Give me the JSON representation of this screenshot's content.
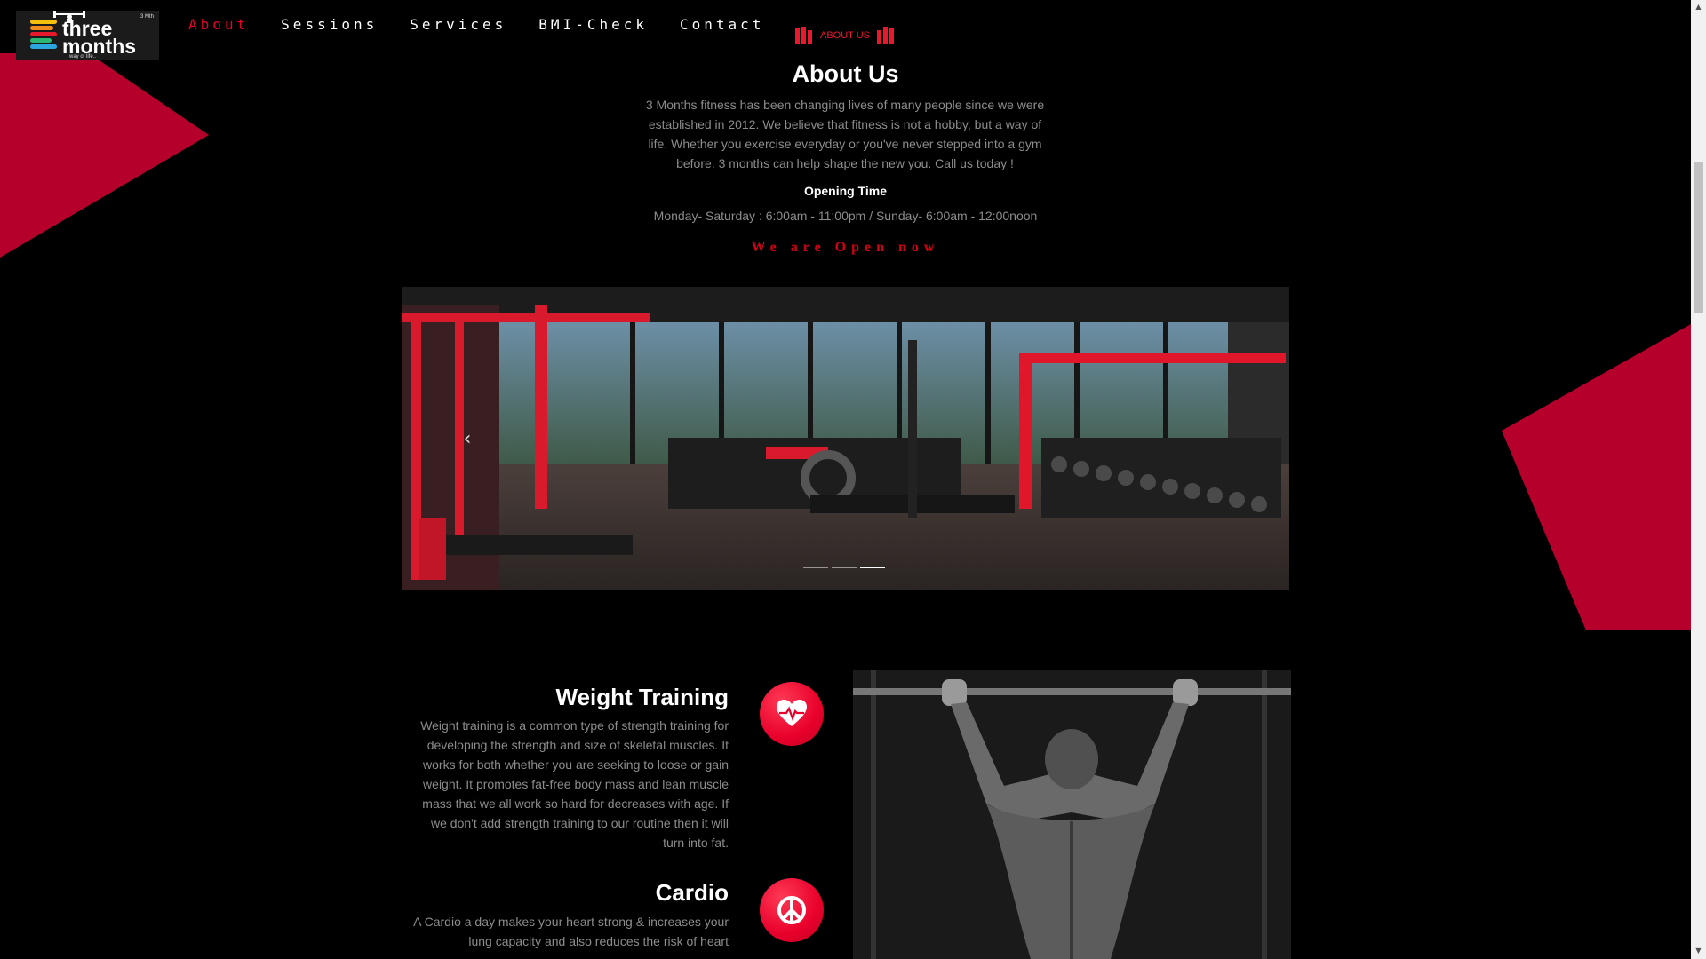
{
  "brand": {
    "logo_line1": "three",
    "logo_line2": "months",
    "tagline": "way of life..",
    "mini_mark": "3 Mth"
  },
  "nav": {
    "items": [
      {
        "label": "About",
        "active": true
      },
      {
        "label": "Sessions",
        "active": false
      },
      {
        "label": "Services",
        "active": false
      },
      {
        "label": "BMI-Check",
        "active": false
      },
      {
        "label": "Contact",
        "active": false
      }
    ]
  },
  "about": {
    "kicker": "ABOUT US",
    "title": "About Us",
    "text": "3 Months fitness has been changing lives of many people since we were established in 2012. We believe that fitness is not a hobby, but a way of life. Whether you exercise everyday or you've never stepped into a gym before. 3 months can help shape the new you. Call us today !",
    "opening_title": "Opening Time",
    "opening_hours": "Monday- Saturday : 6:00am - 11:00pm / Sunday- 6:00am - 12:00noon",
    "status": "We are Open now"
  },
  "carousel": {
    "slide_count": 3,
    "active_index": 2,
    "prev_glyph": "‹"
  },
  "features": [
    {
      "title": "Weight Training",
      "icon": "heartbeat-icon",
      "text": "Weight training is a common type of strength training for developing the strength and size of skeletal muscles. It works for both whether you are seeking to loose or gain weight. It promotes fat-free body mass and lean muscle mass that we all work so hard for decreases with age. If we don't add strength training to our routine then it will turn into fat."
    },
    {
      "title": "Cardio",
      "icon": "peace-icon",
      "text": "A Cardio a day makes your heart strong & increases your lung capacity and also reduces the risk of heart"
    }
  ],
  "colors": {
    "accent": "#e8002b",
    "polygon": "#b5002c",
    "muted_text": "#8c8c8c",
    "background": "#000000"
  }
}
